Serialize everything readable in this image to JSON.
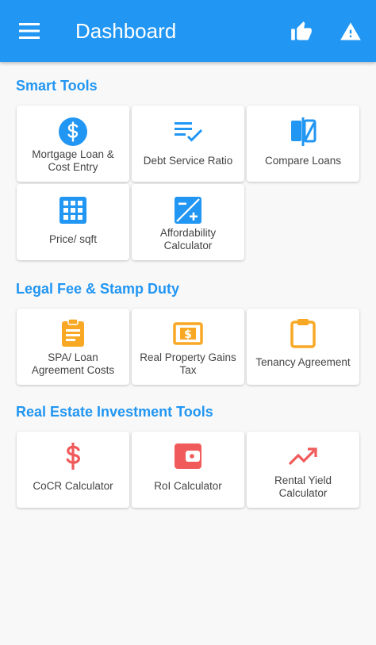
{
  "app_bar": {
    "title": "Dashboard",
    "menu_icon": "hamburger-menu-icon",
    "like_icon": "thumbs-up-icon",
    "alert_icon": "warning-icon",
    "color": "#2196f3"
  },
  "sections": [
    {
      "title": "Smart Tools",
      "cards": [
        {
          "label": "Mortgage Loan & Cost Entry",
          "icon": "dollar-circle-icon"
        },
        {
          "label": "Debt Service Ratio",
          "icon": "checklist-icon"
        },
        {
          "label": "Compare Loans",
          "icon": "compare-icon"
        },
        {
          "label": "Price/ sqft",
          "icon": "grid-icon"
        },
        {
          "label": "Affordability Calculator",
          "icon": "calculator-icon"
        }
      ]
    },
    {
      "title": "Legal Fee & Stamp Duty",
      "cards": [
        {
          "label": "SPA/ Loan Agreement Costs",
          "icon": "clipboard-list-icon"
        },
        {
          "label": "Real Property Gains Tax",
          "icon": "money-icon"
        },
        {
          "label": "Tenancy Agreement",
          "icon": "clipboard-icon"
        }
      ]
    },
    {
      "title": "Real Estate Investment Tools",
      "cards": [
        {
          "label": "CoCR Calculator",
          "icon": "dollar-sign-icon"
        },
        {
          "label": "RoI Calculator",
          "icon": "wallet-icon"
        },
        {
          "label": "Rental Yield Calculator",
          "icon": "trending-up-icon"
        }
      ]
    }
  ],
  "colors": {
    "accent_blue": "#2196f3",
    "accent_orange": "#f9a825",
    "accent_red": "#f05a5a"
  }
}
